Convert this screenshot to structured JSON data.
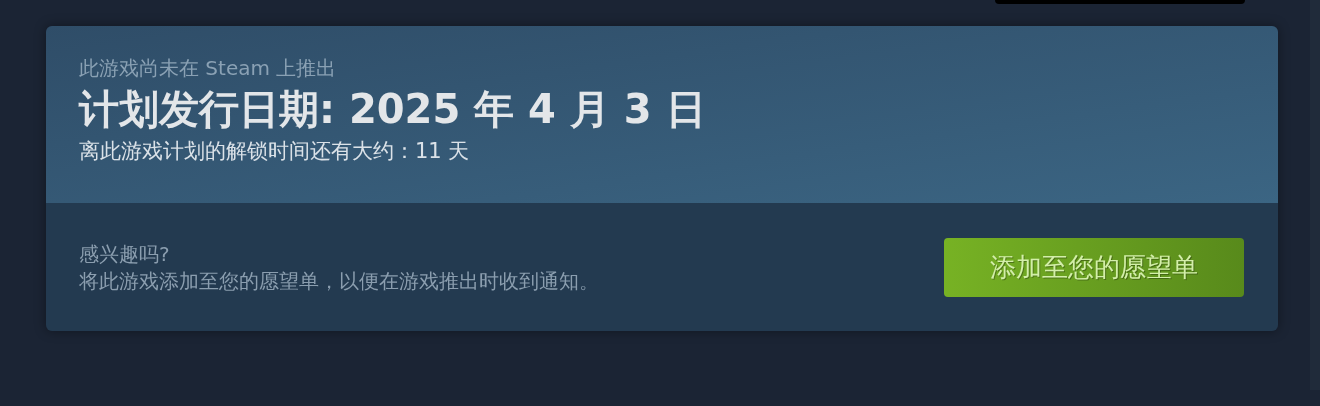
{
  "release": {
    "notice": "此游戏尚未在 Steam 上推出",
    "date_heading": "计划发行日期: 2025 年 4 月 3 日",
    "countdown": "离此游戏计划的解锁时间还有大约：11 天"
  },
  "wishlist": {
    "question": "感兴趣吗?",
    "description": "将此游戏添加至您的愿望单，以便在游戏推出时收到通知。",
    "button": "添加至您的愿望单"
  }
}
